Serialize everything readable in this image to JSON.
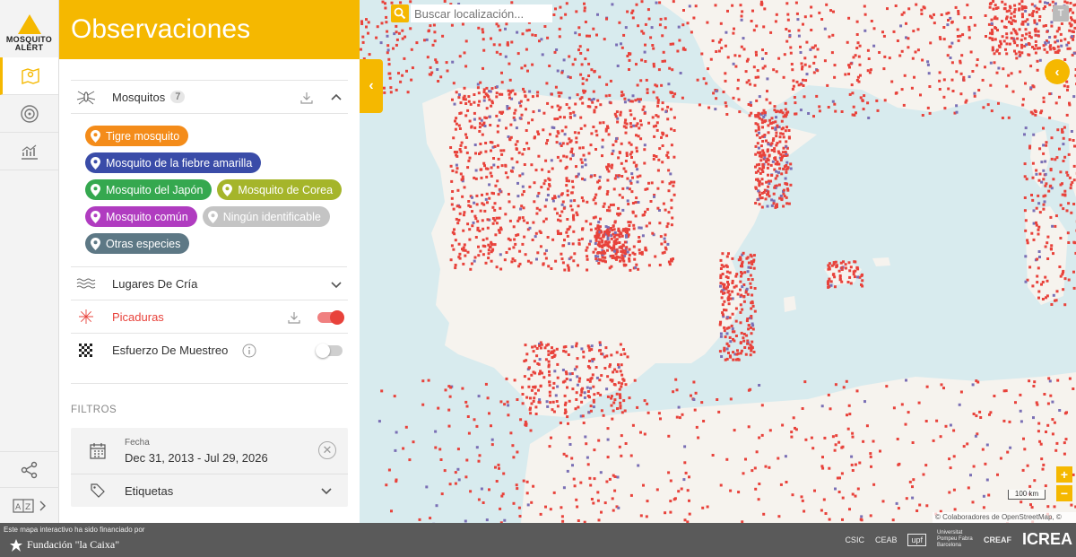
{
  "logo": {
    "line1": "MOSQUITO",
    "line2": "ALERT"
  },
  "panel": {
    "title": "Observaciones"
  },
  "layers": {
    "mosquitos": {
      "label": "Mosquitos",
      "count": "7"
    },
    "chips": [
      {
        "label": "Tigre mosquito",
        "color": "#f48c1a"
      },
      {
        "label": "Mosquito de la fiebre amarilla",
        "color": "#3a4ca8"
      },
      {
        "label": "Mosquito del Japón",
        "color": "#35a84f"
      },
      {
        "label": "Mosquito de Corea",
        "color": "#a5b52a"
      },
      {
        "label": "Mosquito común",
        "color": "#b03cc0"
      },
      {
        "label": "Ningún identificable",
        "color": "#c4c4c4"
      },
      {
        "label": "Otras especies",
        "color": "#5d7885"
      }
    ],
    "breeding": {
      "label": "Lugares De Cría"
    },
    "bites": {
      "label": "Picaduras",
      "color": "#e8423b"
    },
    "sampling": {
      "label": "Esfuerzo De Muestreo"
    }
  },
  "filters": {
    "title": "FILTROS",
    "date_label": "Fecha",
    "date_value": "Dec 31, 2013 - Jul 29, 2026",
    "tags_label": "Etiquetas"
  },
  "map": {
    "search_placeholder": "Buscar localización...",
    "t_button": "T",
    "zoom_in": "+",
    "zoom_out": "−",
    "scale": "100 km",
    "attribution": "© Colaboradores de OpenStreetMap, © Carto"
  },
  "footer": {
    "funded_text": "Este mapa interactivo ha sido financiado por",
    "fundacion": "Fundación \"la Caixa\"",
    "sponsors": [
      "CSIC",
      "CEAB",
      "upf",
      "Universitat Pompeu Fabra Barcelona",
      "CREAF",
      "ICREA"
    ]
  },
  "colors": {
    "accent": "#f5b800",
    "dots": "#e8423b"
  }
}
